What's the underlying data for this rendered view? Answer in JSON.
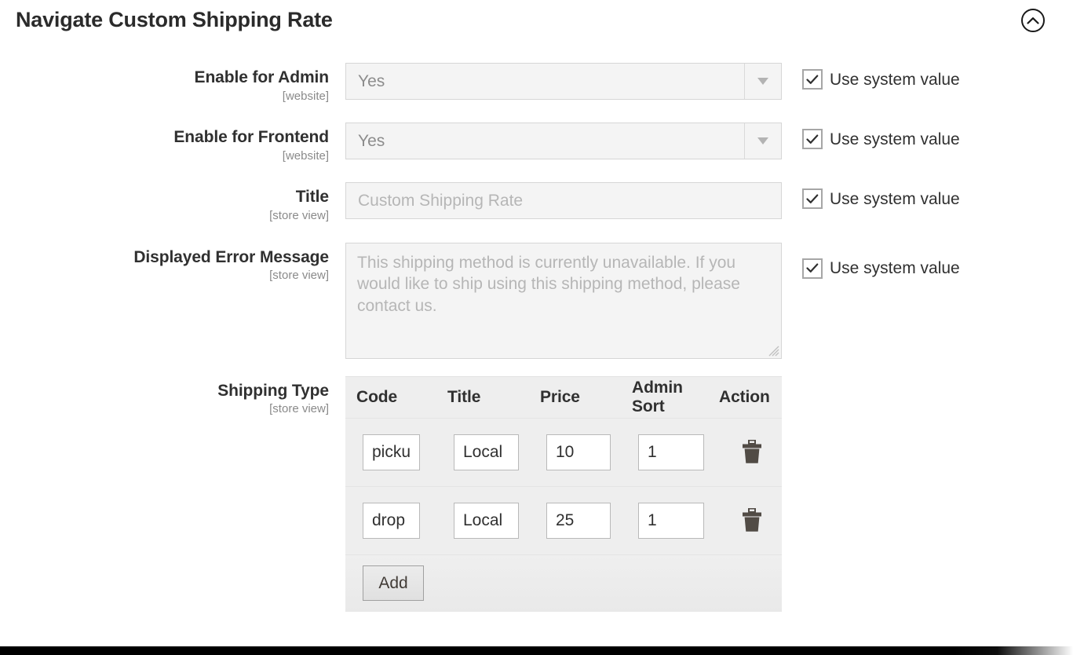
{
  "header": {
    "title": "Navigate Custom Shipping Rate",
    "collapse_icon": "chevron-up-circle-icon"
  },
  "fields": [
    {
      "label": "Enable for Admin",
      "scope": "[website]",
      "type": "select",
      "value": "Yes",
      "use_system_value": true,
      "use_system_label": "Use system value",
      "arrow_icon": "chevron-down-icon"
    },
    {
      "label": "Enable for Frontend",
      "scope": "[website]",
      "type": "select",
      "value": "Yes",
      "use_system_value": true,
      "use_system_label": "Use system value",
      "arrow_icon": "chevron-down-icon"
    },
    {
      "label": "Title",
      "scope": "[store view]",
      "type": "text",
      "value": "Custom Shipping Rate",
      "use_system_value": true,
      "use_system_label": "Use system value"
    },
    {
      "label": "Displayed Error Message",
      "scope": "[store view]",
      "type": "textarea",
      "value": "This shipping method is currently unavailable. If you would like to ship using this shipping method, please contact us.",
      "use_system_value": true,
      "use_system_label": "Use system value"
    },
    {
      "label": "Shipping Type",
      "scope": "[store view]",
      "type": "table"
    }
  ],
  "shipping_table": {
    "columns": [
      "Code",
      "Title",
      "Price",
      "Admin Sort",
      "Action"
    ],
    "rows": [
      {
        "code": "picku",
        "title": "Local",
        "price": "10",
        "admin_sort": "1",
        "delete_icon": "trash-icon"
      },
      {
        "code": "drop",
        "title": "Local",
        "price": "25",
        "admin_sort": "1",
        "delete_icon": "trash-icon"
      }
    ],
    "add_label": "Add"
  },
  "colors": {
    "page_bg": "#ffffff",
    "disabled_field_bg": "#f4f4f4",
    "table_bg": "#eeeeee",
    "label_text": "#303030",
    "scope_text": "#8a8a8a",
    "placeholder_text": "#b6b6b6",
    "trash_icon": "#514b45"
  }
}
